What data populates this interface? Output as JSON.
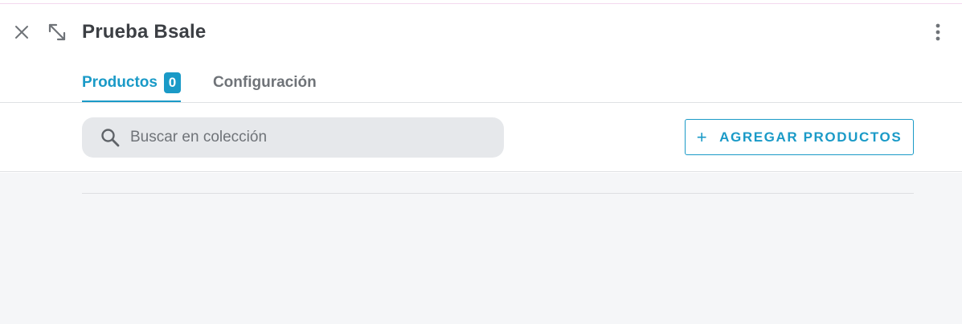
{
  "header": {
    "title": "Prueba Bsale",
    "close_icon": "close-icon",
    "expand_icon": "expand-diagonal-icon",
    "more_icon": "more-vertical-icon"
  },
  "tabs": [
    {
      "label": "Productos",
      "badge": "0",
      "active": true
    },
    {
      "label": "Configuración",
      "active": false
    }
  ],
  "toolbar": {
    "search_placeholder": "Buscar en colección",
    "search_value": "",
    "add_button_icon": "+",
    "add_button_label": "AGREGAR PRODUCTOS"
  },
  "colors": {
    "accent": "#1a9ac7",
    "text": "#3c3f44",
    "muted": "#6f7378",
    "search_bg": "#e6e8eb",
    "content_bg": "#f5f6f8"
  }
}
